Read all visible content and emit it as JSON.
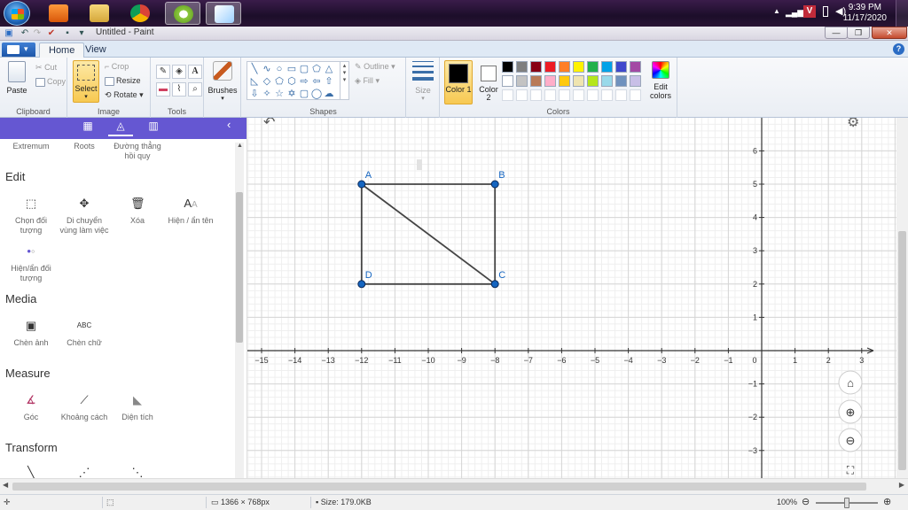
{
  "window": {
    "title": "Untitled - Paint"
  },
  "taskbar": {
    "clock_time": "9:39 PM",
    "clock_date": "11/17/2020"
  },
  "ribbon": {
    "tabs": [
      "Home",
      "View"
    ],
    "clipboard": {
      "paste": "Paste",
      "cut": "Cut",
      "copy": "Copy",
      "label": "Clipboard"
    },
    "image": {
      "select": "Select",
      "crop": "Crop",
      "resize": "Resize",
      "rotate": "Rotate",
      "label": "Image"
    },
    "tools": {
      "label": "Tools"
    },
    "brushes": {
      "label": "Brushes"
    },
    "shapes": {
      "outline": "Outline",
      "fill": "Fill",
      "label": "Shapes"
    },
    "size": {
      "label": "Size"
    },
    "colors": {
      "color1": "Color 1",
      "color2": "Color 2",
      "edit": "Edit colors",
      "label": "Colors",
      "palette_row1": [
        "#000000",
        "#7f7f7f",
        "#880015",
        "#ed1c24",
        "#ff7f27",
        "#fff200",
        "#22b14c",
        "#00a2e8",
        "#3f48cc",
        "#a349a4"
      ],
      "palette_row2": [
        "#ffffff",
        "#c3c3c3",
        "#b97a57",
        "#ffaec9",
        "#ffc90e",
        "#efe4b0",
        "#b5e61d",
        "#99d9ea",
        "#7092be",
        "#c8bfe7"
      ]
    }
  },
  "geogebra_panel": {
    "top_tools": [
      "Extremum",
      "Roots",
      "Đường thẳng hồi quy"
    ],
    "sections": {
      "edit": {
        "title": "Edit",
        "tools": [
          "Chọn đối tượng",
          "Di chuyển vùng làm việc",
          "Xóa",
          "Hiện / ẩn tên",
          "Hiện/ẩn đối tượng"
        ]
      },
      "media": {
        "title": "Media",
        "tools": [
          "Chèn ảnh",
          "Chèn chữ"
        ]
      },
      "measure": {
        "title": "Measure",
        "tools": [
          "Góc",
          "Khoảng cách",
          "Diện tích"
        ]
      },
      "transform": {
        "title": "Transform"
      }
    },
    "insert_text_icon": "ABC"
  },
  "graph": {
    "x_ticks": [
      "−15",
      "−14",
      "−13",
      "−12",
      "−11",
      "−10",
      "−9",
      "−8",
      "−7",
      "−6",
      "−5",
      "−4",
      "−3",
      "−2",
      "−1",
      "0",
      "1",
      "2",
      "3"
    ],
    "y_ticks": [
      "6",
      "5",
      "4",
      "3",
      "2",
      "1",
      "−1",
      "−2",
      "−3"
    ],
    "points": [
      {
        "label": "A",
        "x": -12,
        "y": 5
      },
      {
        "label": "B",
        "x": -8,
        "y": 5
      },
      {
        "label": "C",
        "x": -8,
        "y": 2
      },
      {
        "label": "D",
        "x": -12,
        "y": 2
      }
    ]
  },
  "statusbar": {
    "dimensions": "1366 × 768px",
    "size": "Size: 179.0KB",
    "zoom": "100%"
  }
}
